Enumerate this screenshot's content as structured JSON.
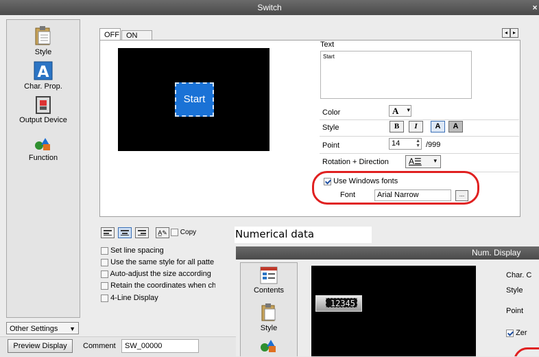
{
  "window": {
    "title": "Switch",
    "close_glyph": "×"
  },
  "sidebar": {
    "items": [
      {
        "label": "Style",
        "icon": "clipboard-icon"
      },
      {
        "label": "Char. Prop.",
        "icon": "letter-a-icon"
      },
      {
        "label": "Output Device",
        "icon": "output-device-icon"
      },
      {
        "label": "Function",
        "icon": "shapes-icon"
      }
    ],
    "other_settings": "Other Settings"
  },
  "tabs": [
    {
      "label": "OFF"
    },
    {
      "label": "ON"
    }
  ],
  "tab_scroll": {
    "left": "◂",
    "right": "▸"
  },
  "preview": {
    "button_text": "Start"
  },
  "text_section": {
    "label": "Text",
    "value": "Start"
  },
  "color": {
    "label": "Color",
    "value": "A",
    "arrow": "▾"
  },
  "style": {
    "label": "Style",
    "bold": "B",
    "italic": "I",
    "shadow": "A",
    "outline": "A"
  },
  "point": {
    "label": "Point",
    "value": "14",
    "max": "/999"
  },
  "rotation": {
    "label": "Rotation + Direction",
    "arrow": "▾"
  },
  "windows_fonts": {
    "label": "Use Windows fonts",
    "checked": true
  },
  "font": {
    "label": "Font",
    "value": "Arial Narrow",
    "browse": "..."
  },
  "options": {
    "copy_label": "Copy",
    "items": [
      "Set line spacing",
      "Use the same style for all patte",
      "Auto-adjust the size according",
      "Retain the coordinates when ch",
      "4-Line Display"
    ]
  },
  "bottom": {
    "preview_button": "Preview Display",
    "comment_label": "Comment",
    "comment_value": "SW_00000"
  },
  "caption": "Numerical data",
  "inset": {
    "title": "Num. Display",
    "sidebar": [
      {
        "label": "Contents"
      },
      {
        "label": "Style"
      }
    ],
    "display_value": "12345",
    "right_labels": [
      "Char. C",
      "Style",
      "Point"
    ],
    "zero_label": "Zer"
  },
  "colors": {
    "accent_red": "#e02020",
    "button_blue": "#1a72d6",
    "titlebar": "#555555"
  }
}
